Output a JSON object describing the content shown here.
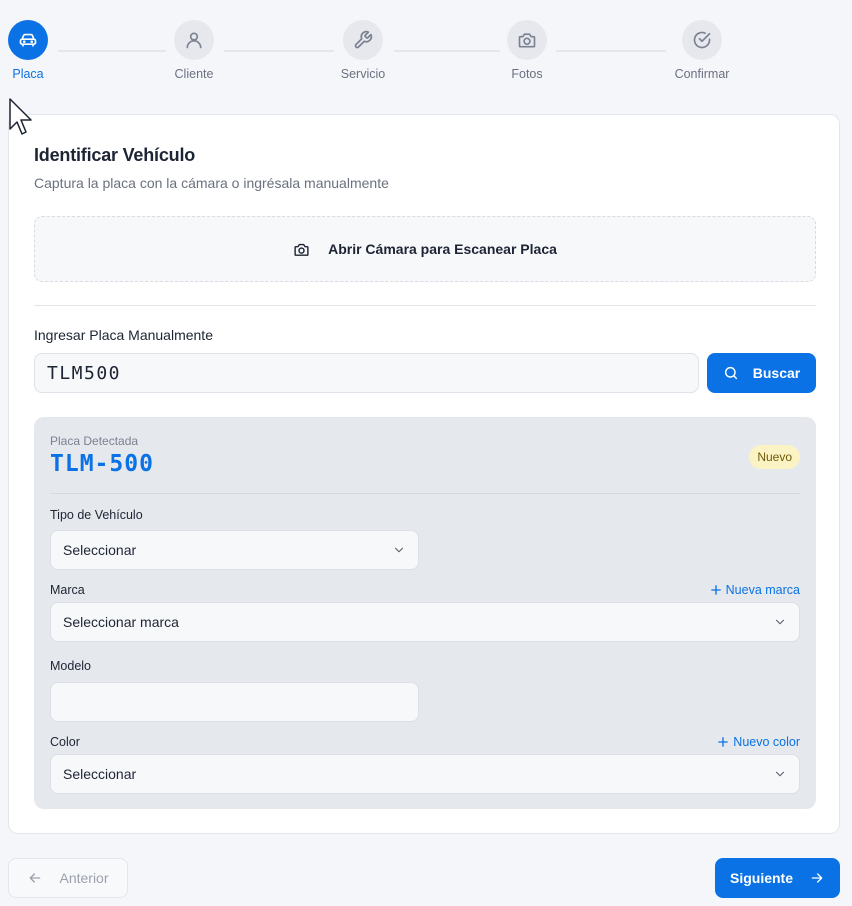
{
  "colors": {
    "accent": "#0a72e5",
    "badge_bg": "#fcf3c5",
    "panel_bg": "#e5e8ed",
    "page_bg": "#f5f6f9"
  },
  "stepper": {
    "active_step": "Placa",
    "steps": [
      {
        "label": "Placa",
        "icon": "car-icon"
      },
      {
        "label": "Cliente",
        "icon": "user-icon"
      },
      {
        "label": "Servicio",
        "icon": "wrench-icon"
      },
      {
        "label": "Fotos",
        "icon": "camera-icon"
      },
      {
        "label": "Confirmar",
        "icon": "check-circle-icon"
      }
    ]
  },
  "identify": {
    "title": "Identificar Vehículo",
    "subtitle": "Captura la placa con la cámara o ingrésala manualmente",
    "camera_button": "Abrir Cámara para Escanear Placa",
    "manual_label": "Ingresar Placa Manualmente",
    "plate_value": "TLM500",
    "search_button": "Buscar"
  },
  "detection": {
    "label": "Placa Detectada",
    "plate": "TLM-500",
    "badge": "Nuevo",
    "vehicle_type": {
      "label": "Tipo de Vehículo",
      "value": "Seleccionar"
    },
    "brand": {
      "label": "Marca",
      "value": "Seleccionar marca",
      "add_link": "Nueva marca"
    },
    "model": {
      "label": "Modelo",
      "value": ""
    },
    "color": {
      "label": "Color",
      "value": "Seleccionar",
      "add_link": "Nuevo color"
    }
  },
  "footer": {
    "prev_button": "Anterior",
    "next_button": "Siguiente"
  }
}
